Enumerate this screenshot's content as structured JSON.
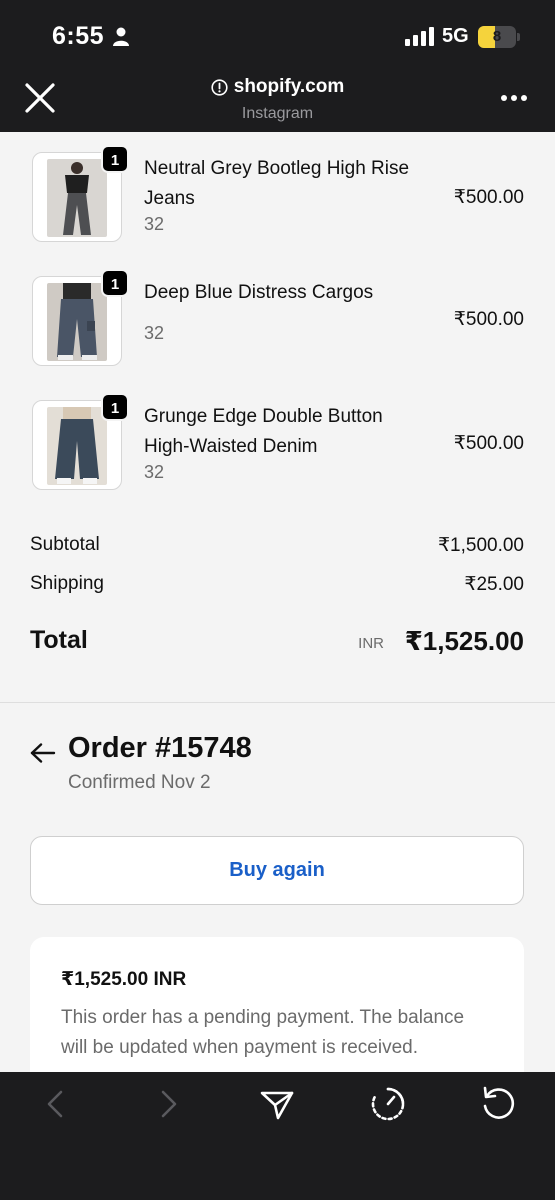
{
  "status_bar": {
    "time": "6:55",
    "network": "5G",
    "battery": "8",
    "battery_level": 0.45,
    "icons": [
      "person-icon",
      "signal-icon",
      "battery-icon"
    ]
  },
  "browser": {
    "domain": "shopify.com",
    "source": "Instagram",
    "icons": [
      "close-icon",
      "info-icon",
      "more-icon"
    ]
  },
  "items": [
    {
      "quantity": "1",
      "title": "Neutral Grey Bootleg High Rise Jeans",
      "variant": "32",
      "price": "₹500.00"
    },
    {
      "quantity": "1",
      "title": "Deep Blue Distress Cargos",
      "variant": "32",
      "price": "₹500.00"
    },
    {
      "quantity": "1",
      "title": "Grunge Edge Double Button High-Waisted Denim",
      "variant": "32",
      "price": "₹500.00"
    }
  ],
  "summary": {
    "subtotal_label": "Subtotal",
    "subtotal_value": "₹1,500.00",
    "shipping_label": "Shipping",
    "shipping_value": "₹25.00",
    "total_label": "Total",
    "total_currency": "INR",
    "total_value": "₹1,525.00"
  },
  "order": {
    "title": "Order #15748",
    "status": "Confirmed Nov 2",
    "buy_again_label": "Buy again",
    "payment_amount": "₹1,525.00 INR",
    "payment_note": "This order has a pending payment. The balance will be updated when payment is received."
  },
  "toolbar": {
    "icons": [
      "back-arrow-icon",
      "forward-arrow-icon",
      "send-icon",
      "timer-icon",
      "reload-icon"
    ]
  },
  "colors": {
    "chrome_bg": "#1c1c1e",
    "page_bg": "#f4f4f4",
    "link_blue": "#1a5fc8",
    "battery_yellow": "#f5d33c"
  }
}
